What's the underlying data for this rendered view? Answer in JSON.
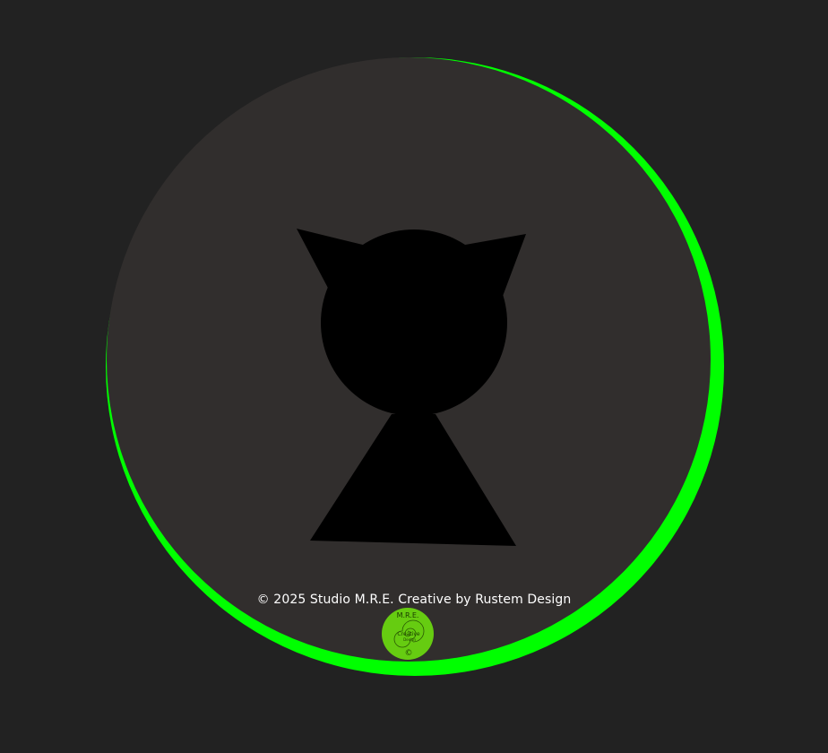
{
  "colors": {
    "background": "#222222",
    "disc": "#312e2d",
    "ring_accent": "#00ff00",
    "silhouette": "#000000",
    "badge_fill": "#66cc11",
    "text": "#ffffff"
  },
  "footer": {
    "copyright": "© 2025 Studio M.R.E. Creative by Rustem Design"
  },
  "badge": {
    "top_text": "M.R.E.",
    "middle_text": "Creative",
    "inner_text": "Design",
    "symbol": "©"
  }
}
